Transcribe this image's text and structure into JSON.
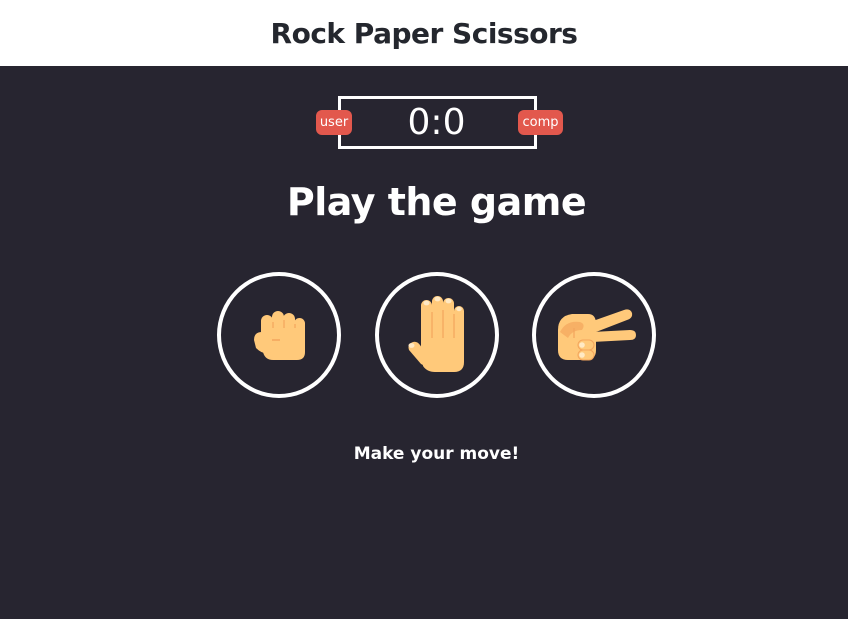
{
  "header": {
    "title": "Rock Paper Scissors"
  },
  "scoreboard": {
    "user_label": "user",
    "comp_label": "comp",
    "score": "0:0",
    "user_badge_color": "#e2584d",
    "comp_badge_color": "#e2584d"
  },
  "main": {
    "title": "Play the game",
    "message": "Make your move!"
  },
  "choices": [
    {
      "name": "rock",
      "icon": "fist-icon"
    },
    {
      "name": "paper",
      "icon": "open-hand-icon"
    },
    {
      "name": "scissors",
      "icon": "scissors-hand-icon"
    }
  ],
  "colors": {
    "background": "#272530",
    "header_bg": "#ffffff",
    "skin": "#ffc97a",
    "skin_shadow": "#f3a55c"
  }
}
